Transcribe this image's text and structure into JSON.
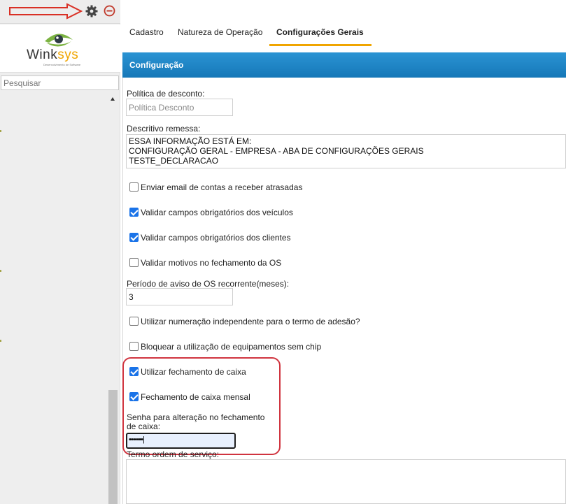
{
  "sidebar": {
    "logo": {
      "brand_left": "Wink",
      "brand_right": "sys",
      "tagline": "Desenvolvimento de Software"
    },
    "search": {
      "placeholder": "Pesquisar",
      "value": ""
    },
    "icons": {
      "settings": "gear-icon",
      "collapse": "minus-circle-icon",
      "annotation": "red-arrow-icon"
    }
  },
  "tabs": [
    {
      "label": "Cadastro",
      "active": false
    },
    {
      "label": "Natureza de Operação",
      "active": false
    },
    {
      "label": "Configurações Gerais",
      "active": true
    }
  ],
  "panel": {
    "title": "Configuração",
    "discount_policy": {
      "label": "Política de desconto:",
      "placeholder": "Política Desconto",
      "value": ""
    },
    "remittance": {
      "label": "Descritivo remessa:",
      "value": "ESSA INFORMAÇÃO ESTÁ EM:\nCONFIGURAÇÃO GERAL - EMPRESA - ABA DE CONFIGURAÇÕES GERAIS\nTESTE_DECLARACAO"
    },
    "checkboxes": [
      {
        "label": "Enviar email de contas a receber atrasadas",
        "checked": false
      },
      {
        "label": "Validar campos obrigatórios dos veículos",
        "checked": true
      },
      {
        "label": "Validar campos obrigatórios dos clientes",
        "checked": true
      },
      {
        "label": "Validar motivos no fechamento da OS",
        "checked": false
      },
      {
        "label": "Utilizar numeração independente para o termo de adesão?",
        "checked": false
      },
      {
        "label": "Bloquear a utilização de equipamentos sem chip",
        "checked": false
      },
      {
        "label": "Utilizar fechamento de caixa",
        "checked": true
      },
      {
        "label": "Fechamento de caixa mensal",
        "checked": true
      }
    ],
    "recurring_os": {
      "label": "Período de aviso de OS recorrente(meses):",
      "value": "3"
    },
    "cash_password": {
      "label_line1": "Senha para alteração no fechamento",
      "label_line2": "de caixa:",
      "value": "•••••••|"
    },
    "service_order_term": {
      "label": "Termo ordem de serviço:",
      "value": ""
    }
  },
  "colors": {
    "accent": "#f0a500",
    "header": "#1a86c8",
    "checkbox": "#1a73e8",
    "highlight": "#d0343f"
  }
}
